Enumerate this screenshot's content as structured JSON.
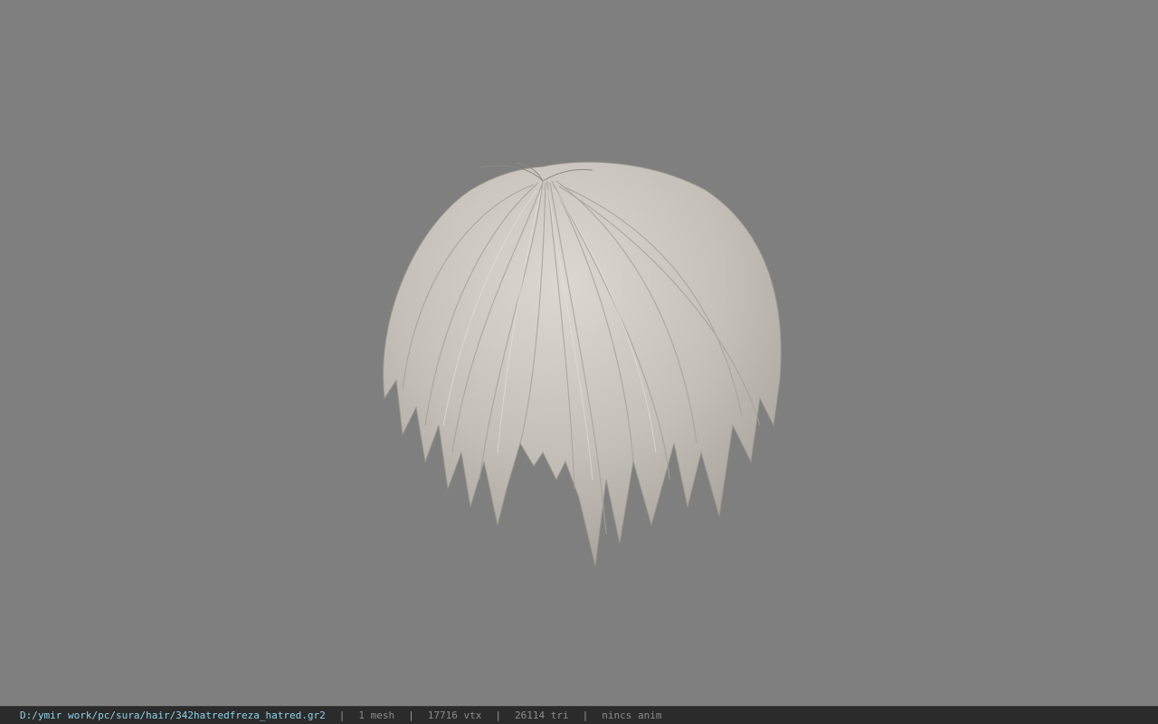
{
  "viewer": {
    "background_color": "#7f7f7f",
    "model_icon": "hair-mesh",
    "model_color": "#c9c5be"
  },
  "statusbar": {
    "file_path": "D:/ymir work/pc/sura/hair/342hatredfreza_hatred.gr2",
    "separator": "|",
    "mesh_count": "1 mesh",
    "vertex_count": "17716 vtx",
    "triangle_count": "26114 tri",
    "anim_status": "nincs anim"
  }
}
